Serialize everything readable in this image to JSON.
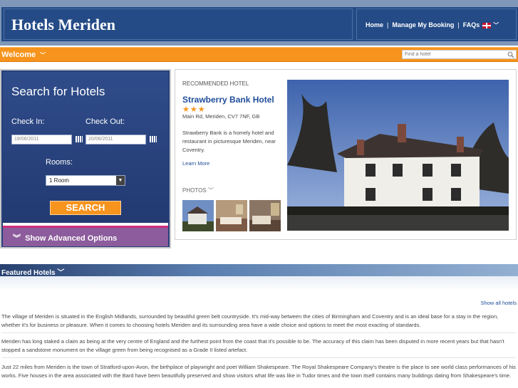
{
  "header": {
    "logo": "Hotels Meriden",
    "nav": [
      "Home",
      "Manage My Booking",
      "FAQs"
    ]
  },
  "welcome_bar": {
    "label": "Welcome",
    "search_placeholder": "Find a hotel"
  },
  "search_panel": {
    "title": "Search for Hotels",
    "check_in_label": "Check In:",
    "check_out_label": "Check Out:",
    "check_in_value": "19/06/2011",
    "check_out_value": "20/06/2011",
    "rooms_label": "Rooms:",
    "rooms_value": "1 Room",
    "search_button": "SEARCH",
    "advanced_label": "Show Advanced Options"
  },
  "recommended": {
    "label": "RECOMMENDED HOTEL",
    "name": "Strawberry Bank Hotel",
    "stars": "★★★",
    "address": "Main Rd, Meriden, CV7 7NF, GB",
    "description": "Strawberry Bank is a homely hotel and restaurant in picturesque Meriden, near Coventry.",
    "learn_more": "Learn More",
    "photos_label": "PHOTOS"
  },
  "featured": {
    "label": "Featured Hotels",
    "show_all": "Show all hotels"
  },
  "content": {
    "paragraphs": [
      "The village of Meriden is situated in the English Midlands, surrounded by beautiful green belt countryside. It's mid-way between the cities of Birmingham and Coventry and is an ideal base for a stay in the region, whether it's for business or pleasure. When it comes to choosing hotels Meriden and its surrounding area have a wide choice and options to meet the most exacting of standards.",
      "Meriden has long staked a claim as being at the very centre of England and the furthest point from the coast that it's possible to be. The accuracy of this claim has been disputed in more recent years but that hasn't stopped a sandstone monument on the village green from being recognised as a Grade II listed artefact.",
      "Just 22 miles from Meriden is the town of Stratford-upon-Avon, the birthplace of playwright and poet William Shakespeare. The Royal Shakespeare Company's theatre is the place to see world class performances of his works. Five houses in the area associated with the Bard have been beautifully preserved and show visitors what life was like in Tudor times and the town itself contains many buildings dating from Shakespeare's time."
    ]
  },
  "colors": {
    "header_blue": "#244b86",
    "accent_orange": "#f7941d",
    "panel_blue": "#27407b",
    "link_blue": "#1f4d9a",
    "advanced_purple": "#8c5c9c"
  }
}
